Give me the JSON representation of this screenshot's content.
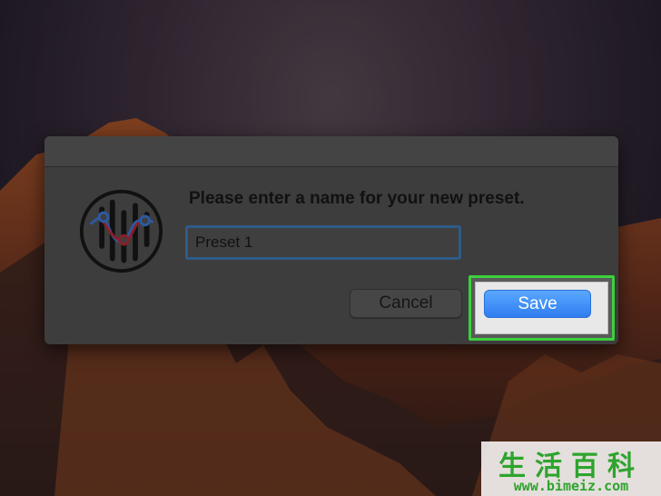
{
  "dialog": {
    "prompt": "Please enter a name for your new preset.",
    "input_value": "Preset 1",
    "cancel_label": "Cancel",
    "save_label": "Save",
    "app_icon": "equalizer-icon"
  },
  "watermark": {
    "chars": "生活百科",
    "url": "www.bimeiz.com"
  },
  "colors": {
    "highlight": "#3bd13b",
    "save_button": "#2f7df0",
    "input_focus": "#2e5b8a"
  }
}
